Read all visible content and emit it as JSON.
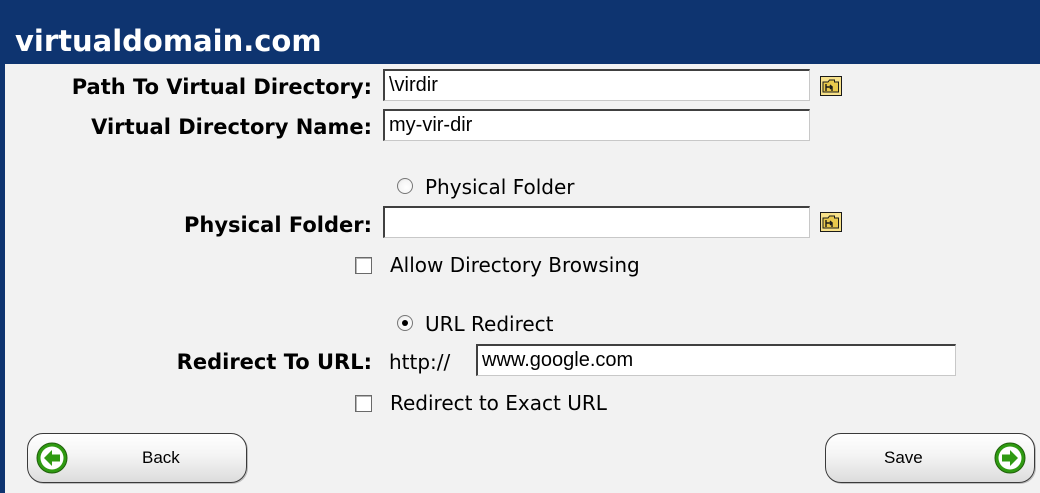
{
  "window": {
    "title": "virtualdomain.com",
    "colors": {
      "titlebar": "#0e3470",
      "background": "#f2f2f2",
      "arrow_green": "#2f9a12"
    }
  },
  "form": {
    "path_label": "Path To Virtual Directory:",
    "path_value": "\\virdir",
    "name_label": "Virtual Directory Name:",
    "name_value": "my-vir-dir",
    "physical_option": {
      "label": "Physical Folder",
      "selected": false
    },
    "physical_label": "Physical Folder:",
    "physical_value": "",
    "allow_browsing": {
      "label": "Allow Directory Browsing",
      "checked": false
    },
    "redirect_option": {
      "label": "URL Redirect",
      "selected": true
    },
    "redirect_label": "Redirect To URL:",
    "redirect_prefix": "http://",
    "redirect_value": "www.google.com",
    "exact_url": {
      "label": "Redirect to Exact URL",
      "checked": false
    }
  },
  "footer": {
    "back_label": "Back",
    "save_label": "Save",
    "icons": {
      "back": "arrow-left-icon",
      "save": "arrow-right-icon",
      "browse": "folder-icon"
    }
  }
}
